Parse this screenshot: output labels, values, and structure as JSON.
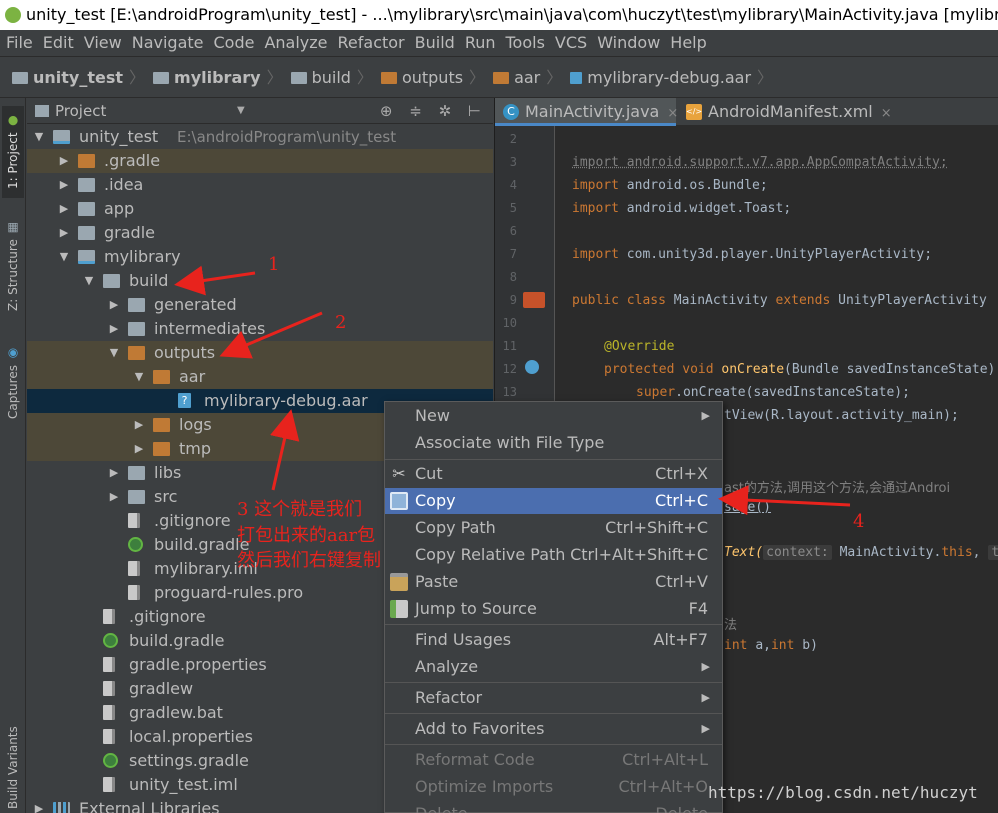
{
  "window": {
    "title": "unity_test [E:\\androidProgram\\unity_test] - ...\\mylibrary\\src\\main\\java\\com\\huczyt\\test\\mylibrary\\MainActivity.java [mylibrary] - Andro"
  },
  "menubar": [
    "File",
    "Edit",
    "View",
    "Navigate",
    "Code",
    "Analyze",
    "Refactor",
    "Build",
    "Run",
    "Tools",
    "VCS",
    "Window",
    "Help"
  ],
  "breadcrumb": [
    "unity_test",
    "mylibrary",
    "build",
    "outputs",
    "aar",
    "mylibrary-debug.aar"
  ],
  "toolstrip": {
    "project_tab": "1: Project",
    "structure_tab": "Z: Structure",
    "captures_tab": "Captures",
    "variants_tab": "Build Variants"
  },
  "project_panel": {
    "view_label": "Project",
    "dropdown_icon": "dropdown-arrow",
    "tools": "⊕ ≑ ✲ ⊢"
  },
  "tree": [
    {
      "label": "unity_test",
      "path": "E:\\androidProgram\\unity_test",
      "icon": "module-icon",
      "arrow": "▼"
    },
    {
      "label": ".gradle",
      "icon": "folder-orange-icon",
      "arrow": "▶"
    },
    {
      "label": ".idea",
      "icon": "folder-icon",
      "arrow": "▶"
    },
    {
      "label": "app",
      "icon": "folder-icon",
      "arrow": "▶"
    },
    {
      "label": "gradle",
      "icon": "folder-icon",
      "arrow": "▶"
    },
    {
      "label": "mylibrary",
      "icon": "library-module-icon",
      "arrow": "▼"
    },
    {
      "label": "build",
      "icon": "folder-icon",
      "arrow": "▼"
    },
    {
      "label": "generated",
      "icon": "folder-icon",
      "arrow": "▶"
    },
    {
      "label": "intermediates",
      "icon": "folder-icon",
      "arrow": "▶"
    },
    {
      "label": "outputs",
      "icon": "folder-orange-icon",
      "arrow": "▼"
    },
    {
      "label": "aar",
      "icon": "folder-orange-icon",
      "arrow": "▼"
    },
    {
      "label": "mylibrary-debug.aar",
      "icon": "aar-file-icon",
      "arrow": ""
    },
    {
      "label": "logs",
      "icon": "folder-orange-icon",
      "arrow": "▶"
    },
    {
      "label": "tmp",
      "icon": "folder-orange-icon",
      "arrow": "▶"
    },
    {
      "label": "libs",
      "icon": "folder-icon",
      "arrow": "▶"
    },
    {
      "label": "src",
      "icon": "folder-icon",
      "arrow": "▶"
    },
    {
      "label": ".gitignore",
      "icon": "file-icon",
      "arrow": ""
    },
    {
      "label": "build.gradle",
      "icon": "gradle-icon",
      "arrow": ""
    },
    {
      "label": "mylibrary.iml",
      "icon": "iml-file-icon",
      "arrow": ""
    },
    {
      "label": "proguard-rules.pro",
      "icon": "file-icon",
      "arrow": ""
    },
    {
      "label": ".gitignore",
      "icon": "file-icon",
      "arrow": ""
    },
    {
      "label": "build.gradle",
      "icon": "gradle-icon",
      "arrow": ""
    },
    {
      "label": "gradle.properties",
      "icon": "file-icon",
      "arrow": ""
    },
    {
      "label": "gradlew",
      "icon": "file-icon",
      "arrow": ""
    },
    {
      "label": "gradlew.bat",
      "icon": "file-icon",
      "arrow": ""
    },
    {
      "label": "local.properties",
      "icon": "file-icon",
      "arrow": ""
    },
    {
      "label": "settings.gradle",
      "icon": "gradle-icon",
      "arrow": ""
    },
    {
      "label": "unity_test.iml",
      "icon": "iml-file-icon",
      "arrow": ""
    },
    {
      "label": "External Libraries",
      "icon": "external-libraries-icon",
      "arrow": "▶"
    }
  ],
  "editor": {
    "tabs": [
      {
        "label": "MainActivity.java",
        "close": "×",
        "icon": "C"
      },
      {
        "label": "AndroidManifest.xml",
        "close": "×",
        "icon": "</>"
      }
    ],
    "line_numbers": [
      "2",
      "3",
      "4",
      "5",
      "6",
      "7",
      "8",
      "9",
      "10",
      "11",
      "12",
      "13"
    ],
    "code": {
      "l3": "import android.support.v7.app.AppCompatActivity;",
      "l4a": "import ",
      "l4b": "android.os.Bundle;",
      "l5a": "import ",
      "l5b": "android.widget.Toast;",
      "l7a": "import ",
      "l7b": "com.unity3d.player.UnityPlayerActivity;",
      "l9a": "public class ",
      "l9b": "MainActivity ",
      "l9c": "extends ",
      "l9d": "UnityPlayerActivity",
      "l11": "@Override",
      "l12a": "protected void ",
      "l12b": "onCreate",
      "l12c": "(Bundle savedInstanceState)",
      "l13a": "super",
      "l13b": ".onCreate(savedInstanceState);",
      "l14": "tView(R.layout.activity_main);",
      "l17": "ast的方法,调用这个方法,会通过Androi",
      "l18": "sage()",
      "l19a": "Text(",
      "l19b": "context:",
      "l19c": " MainActivity.",
      "l19d": "this",
      "l19e": ",",
      "l19f": "text",
      "l22": "法",
      "l23a": "int ",
      "l23b": "a,",
      "l23c": "int ",
      "l23d": "b)"
    }
  },
  "context_menu": [
    {
      "label": "New",
      "shortcut": "",
      "submenu": "▶"
    },
    {
      "label": "Associate with File Type",
      "shortcut": ""
    },
    {
      "label": "Cut",
      "shortcut": "Ctrl+X",
      "icon": "cut-icon"
    },
    {
      "label": "Copy",
      "shortcut": "Ctrl+C",
      "icon": "copy-icon",
      "selected": true
    },
    {
      "label": "Copy Path",
      "shortcut": "Ctrl+Shift+C"
    },
    {
      "label": "Copy Relative Path",
      "shortcut": "Ctrl+Alt+Shift+C"
    },
    {
      "label": "Paste",
      "shortcut": "Ctrl+V",
      "icon": "paste-icon"
    },
    {
      "label": "Jump to Source",
      "shortcut": "F4",
      "icon": "jump-to-source-icon"
    },
    {
      "label": "Find Usages",
      "shortcut": "Alt+F7"
    },
    {
      "label": "Analyze",
      "shortcut": "",
      "submenu": "▶"
    },
    {
      "label": "Refactor",
      "shortcut": "",
      "submenu": "▶"
    },
    {
      "label": "Add to Favorites",
      "shortcut": "",
      "submenu": "▶"
    },
    {
      "label": "Reformat Code",
      "shortcut": "Ctrl+Alt+L",
      "disabled": true
    },
    {
      "label": "Optimize Imports",
      "shortcut": "Ctrl+Alt+O",
      "disabled": true
    },
    {
      "label": "Delete...",
      "shortcut": "Delete",
      "disabled": true
    }
  ],
  "annotations": {
    "a1": "1",
    "a2": "2",
    "a3_line1": "3 这个就是我们",
    "a3_line2": "打包出来的aar包",
    "a3_line3": "然后我们右键复制",
    "a4": "4"
  },
  "watermark": "https://blog.csdn.net/huczyt",
  "colors": {
    "selection": "#4b6eaf",
    "tree_selection": "#0d293e",
    "annotation": "#e8231d",
    "folder_highlight": "#4d4838"
  }
}
